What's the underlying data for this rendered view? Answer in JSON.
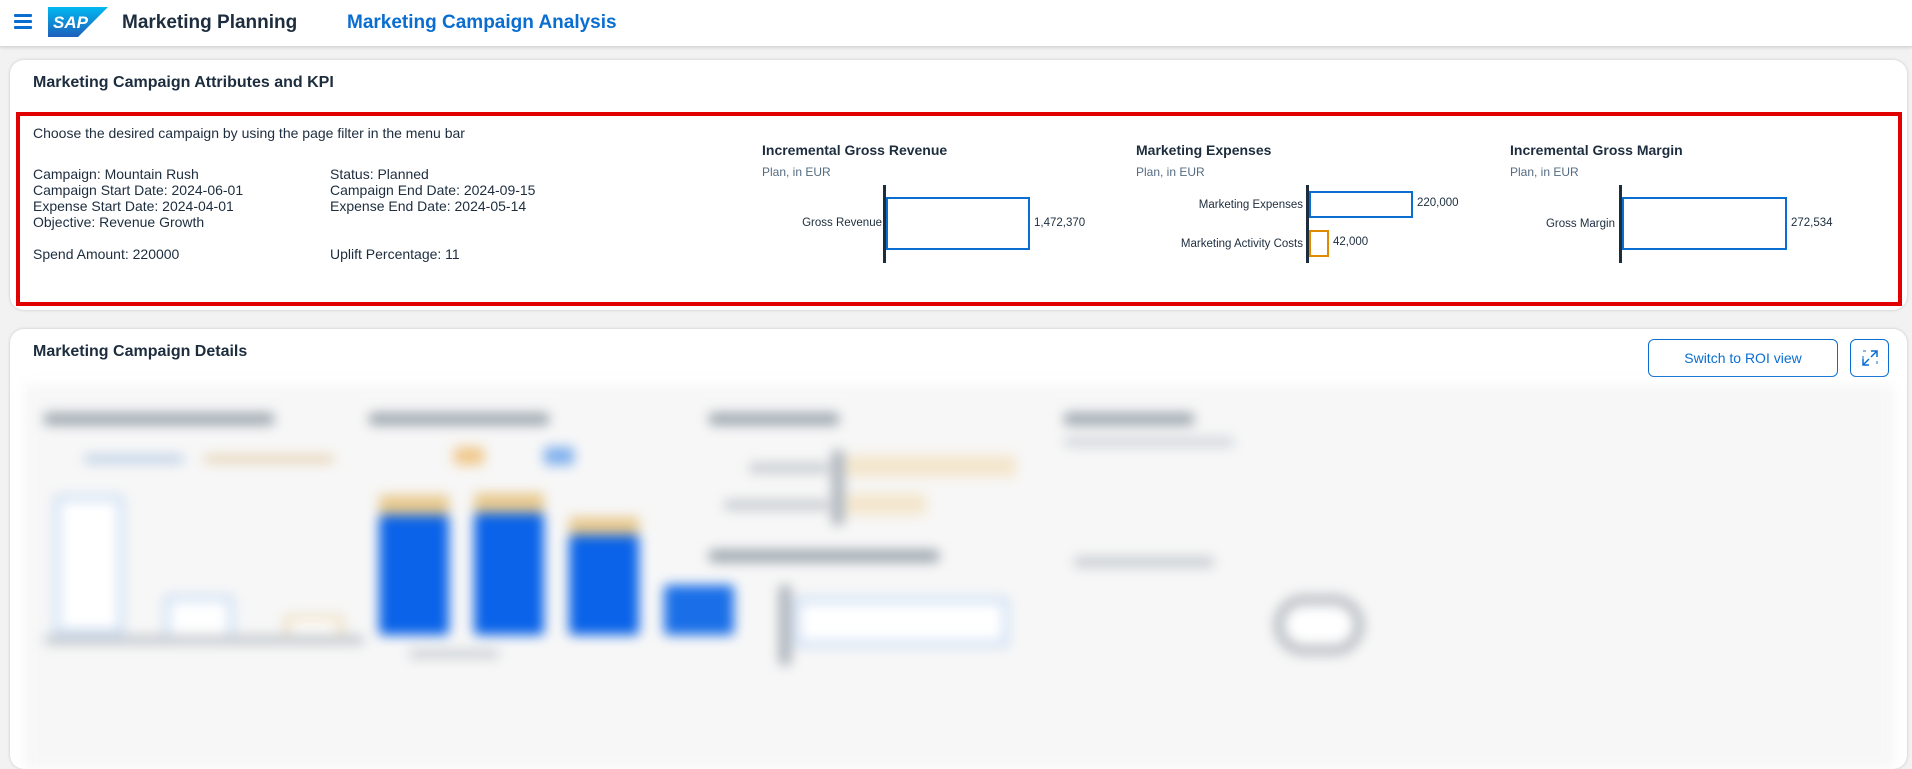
{
  "shell": {
    "logo_text": "SAP",
    "app_title": "Marketing Planning",
    "page_title": "Marketing Campaign Analysis"
  },
  "kpi_card": {
    "title": "Marketing Campaign Attributes and KPI",
    "instruction": "Choose the desired campaign by using the page filter in the menu bar",
    "attributes": {
      "campaign": "Campaign: Mountain Rush",
      "start_date": "Campaign Start Date: 2024-06-01",
      "expense_start": "Expense Start Date: 2024-04-01",
      "objective": "Objective: Revenue Growth",
      "spend": "Spend Amount: 220000",
      "status": "Status: Planned",
      "end_date": "Campaign End Date: 2024-09-15",
      "expense_end": "Expense End Date: 2024-05-14",
      "uplift": "Uplift Percentage: 11"
    }
  },
  "chart_data": [
    {
      "type": "bar",
      "title": "Incremental Gross Revenue",
      "subtitle": "Plan, in EUR",
      "categories": [
        "Gross Revenue"
      ],
      "values": [
        1472370
      ],
      "value_labels": [
        "1,472,370"
      ],
      "colors": [
        "#0a6ed1"
      ]
    },
    {
      "type": "bar",
      "title": "Marketing Expenses",
      "subtitle": "Plan, in EUR",
      "categories": [
        "Marketing Expenses",
        "Marketing Activity Costs"
      ],
      "values": [
        220000,
        42000
      ],
      "value_labels": [
        "220,000",
        "42,000"
      ],
      "colors": [
        "#0a6ed1",
        "#e08a00"
      ]
    },
    {
      "type": "bar",
      "title": "Incremental Gross Margin",
      "subtitle": "Plan, in EUR",
      "categories": [
        "Gross Margin"
      ],
      "values": [
        272534
      ],
      "value_labels": [
        "272,534"
      ],
      "colors": [
        "#0a6ed1"
      ]
    }
  ],
  "details_card": {
    "title": "Marketing Campaign Details",
    "roi_button_label": "Switch to ROI view",
    "expand_icon": "expand-icon"
  },
  "colors": {
    "accent": "#0a6ed1",
    "highlight": "#e00000",
    "orange": "#e08a00"
  }
}
